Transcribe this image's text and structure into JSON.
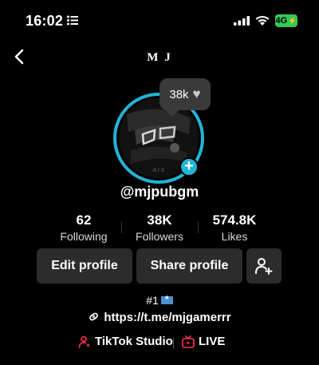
{
  "status_bar": {
    "time": "16:02",
    "network": "4G"
  },
  "nav": {
    "title": "M J"
  },
  "avatar": {
    "likes_bubble": "38k"
  },
  "profile": {
    "username": "@mjpubgm"
  },
  "stats": [
    {
      "value": "62",
      "label": "Following"
    },
    {
      "value": "38K",
      "label": "Followers"
    },
    {
      "value": "574.8K",
      "label": "Likes"
    }
  ],
  "buttons": {
    "edit": "Edit profile",
    "share": "Share profile"
  },
  "bio": {
    "rank": "#1",
    "link": "https://t.me/mjgamerrr"
  },
  "bottom": {
    "studio": "TikTok Studio",
    "live": "LIVE"
  },
  "colors": {
    "ring": "#20b5d8",
    "accent_red": "#fe2c55",
    "battery": "#36c759"
  }
}
